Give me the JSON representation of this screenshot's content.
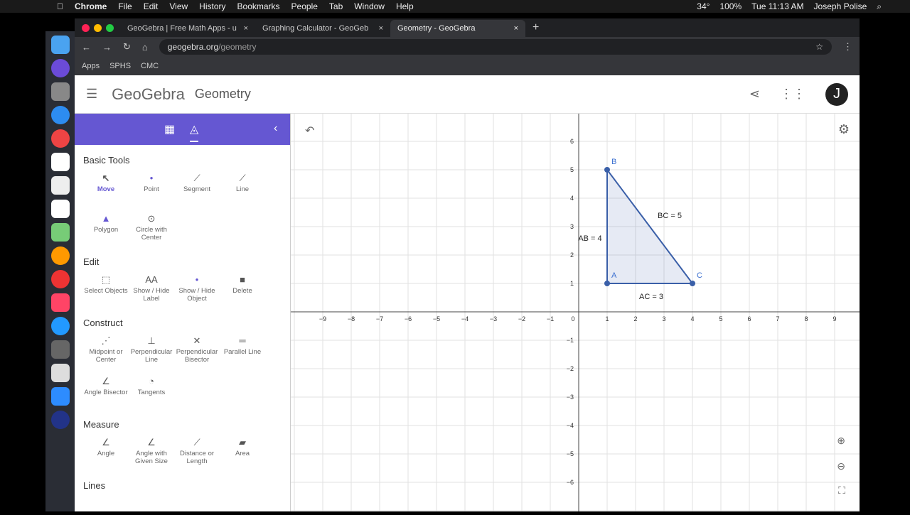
{
  "menubar": {
    "apple": "",
    "app": "Chrome",
    "items": [
      "File",
      "Edit",
      "View",
      "History",
      "Bookmarks",
      "People",
      "Tab",
      "Window",
      "Help"
    ],
    "temp": "34°",
    "battery": "100%",
    "time": "Tue 11:13 AM",
    "user": "Joseph Polise"
  },
  "tabs": [
    {
      "label": "GeoGebra | Free Math Apps - u"
    },
    {
      "label": "Graphing Calculator - GeoGeb"
    },
    {
      "label": "Geometry - GeoGebra"
    }
  ],
  "address": {
    "host": "geogebra.org",
    "path": "/geometry"
  },
  "bookmarks": [
    "Apps",
    "SPHS",
    "CMC"
  ],
  "header": {
    "logo": "GeoGebra",
    "title": "Geometry",
    "avatar": "J"
  },
  "sections": [
    {
      "title": "Basic Tools",
      "tools": [
        "Move",
        "Point",
        "Segment",
        "Line",
        "Polygon",
        "Circle with Center"
      ]
    },
    {
      "title": "Edit",
      "tools": [
        "Select Objects",
        "Show / Hide Label",
        "Show / Hide Object",
        "Delete"
      ]
    },
    {
      "title": "Construct",
      "tools": [
        "Midpoint or Center",
        "Perpendicular Line",
        "Perpendicular Bisector",
        "Parallel Line",
        "Angle Bisector",
        "Tangents"
      ]
    },
    {
      "title": "Measure",
      "tools": [
        "Angle",
        "Angle with Given Size",
        "Distance or Length",
        "Area"
      ]
    },
    {
      "title": "Lines",
      "tools": []
    }
  ],
  "graph": {
    "xrange": [
      -10,
      10
    ],
    "yrange": [
      -7,
      7
    ],
    "points": [
      {
        "name": "A",
        "x": 1,
        "y": 1
      },
      {
        "name": "B",
        "x": 1,
        "y": 5
      },
      {
        "name": "C",
        "x": 4,
        "y": 1
      }
    ],
    "labels": [
      {
        "text": "AB = 4",
        "x": 0.4,
        "y": 2.5
      },
      {
        "text": "BC = 5",
        "x": 3.2,
        "y": 3.3
      },
      {
        "text": "AC = 3",
        "x": 2.55,
        "y": 0.45
      }
    ],
    "color": "#3a5fa8"
  }
}
